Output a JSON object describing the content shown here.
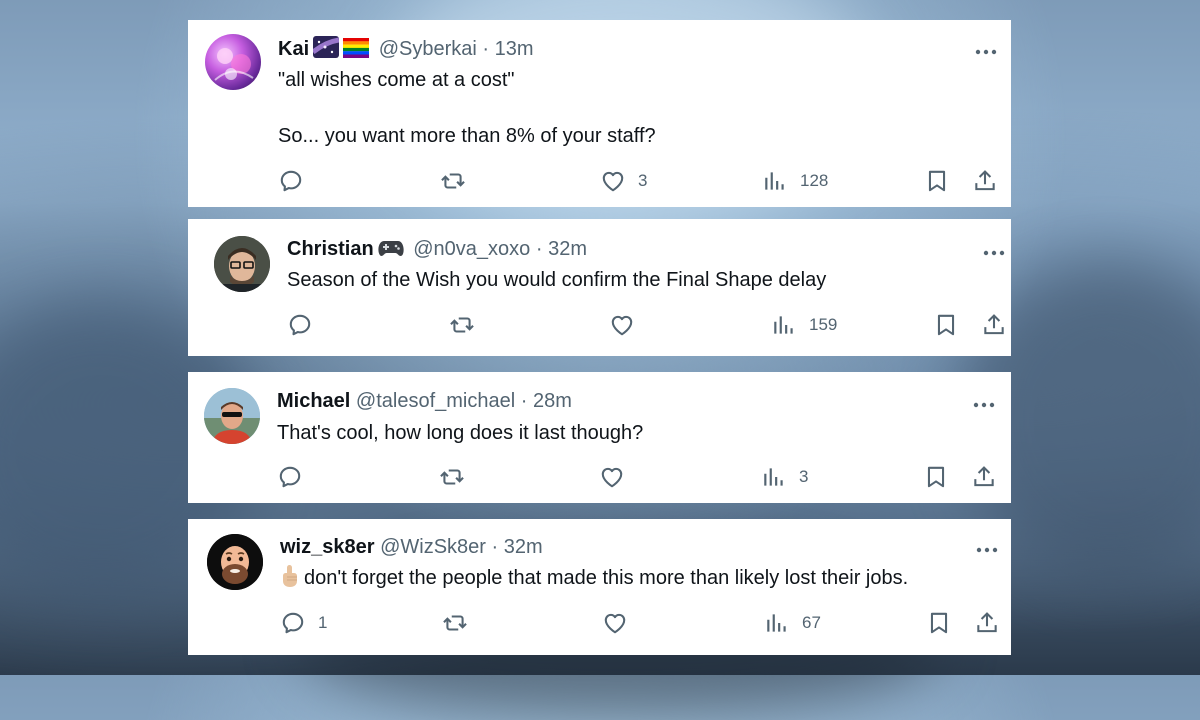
{
  "tweets": [
    {
      "name": "Kai",
      "handle": "@Syberkai",
      "time": "13m",
      "text_lines": [
        "\"all wishes come at a cost\"",
        "",
        "So... you want more than 8% of your staff?"
      ],
      "reply_count": "",
      "like_count": "3",
      "view_count": "128",
      "name_emojis": [
        "milky-way-emoji",
        "rainbow-flag-emoji"
      ]
    },
    {
      "name": "Christian",
      "handle": "@n0va_xoxo",
      "time": "32m",
      "text_lines": [
        "Season of the Wish you would confirm the Final Shape delay"
      ],
      "reply_count": "",
      "like_count": "",
      "view_count": "159",
      "name_emojis": [
        "game-controller-emoji"
      ]
    },
    {
      "name": "Michael",
      "handle": "@talesof_michael",
      "time": "28m",
      "text_lines": [
        "That's cool, how long does it last though?"
      ],
      "reply_count": "",
      "like_count": "",
      "view_count": "3",
      "name_emojis": []
    },
    {
      "name": "wiz_sk8er",
      "handle": "@WizSk8er",
      "time": "32m",
      "text_lines": [
        "don't forget the people that made this more than likely lost their jobs."
      ],
      "reply_count": "1",
      "like_count": "",
      "view_count": "67",
      "name_emojis": [],
      "text_emoji": "pointing-up-emoji"
    }
  ],
  "separator": "·",
  "colors": {
    "text_primary": "#0f1419",
    "text_secondary": "#536471",
    "card_background": "#ffffff"
  }
}
